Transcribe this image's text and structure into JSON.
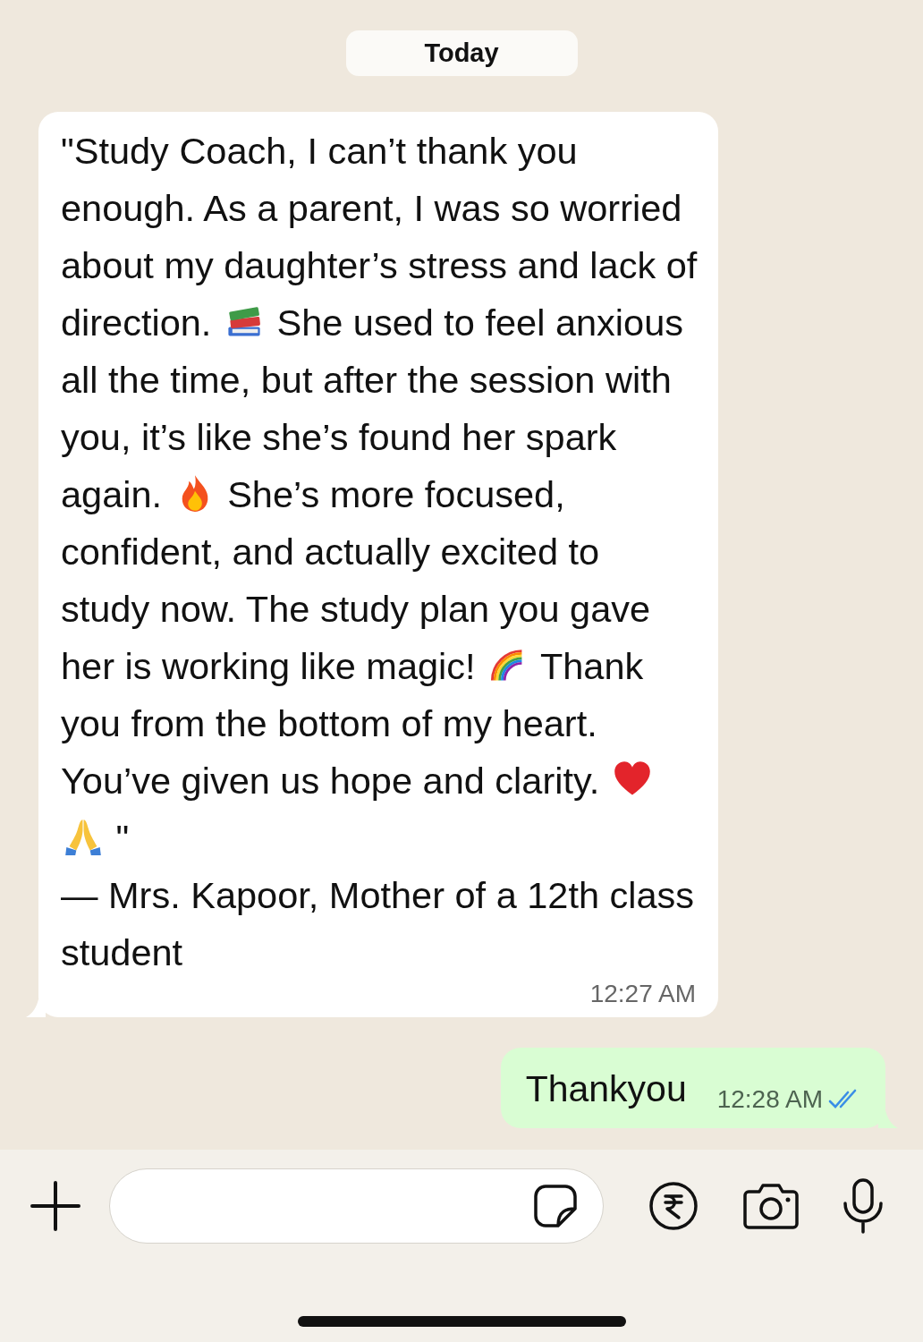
{
  "date_chip": "Today",
  "messages": [
    {
      "kind": "incoming",
      "segments": [
        {
          "kind": "text",
          "text": "\"Study Coach, I can’t thank you enough. As a parent, I was so worried about my daughter’s stress and lack of direction. "
        },
        {
          "kind": "books"
        },
        {
          "kind": "text",
          "text": " She used to feel anxious all the time, but after the session with you, it’s like she’s found her spark again. "
        },
        {
          "kind": "fire"
        },
        {
          "kind": "text",
          "text": " She’s more focused, confident, and actually excited to study now. The study plan you gave her is working like magic! "
        },
        {
          "kind": "rainbow"
        },
        {
          "kind": "text",
          "text": " Thank you from the bottom of my heart. You’ve given us hope and clarity. "
        },
        {
          "kind": "heart"
        },
        {
          "kind": "hands"
        },
        {
          "kind": "text",
          "text": " \""
        }
      ],
      "signature": "— Mrs. Kapoor, Mother of a 12th class student",
      "time": "12:27 AM",
      "read": false
    },
    {
      "kind": "outgoing",
      "segments": [
        {
          "kind": "text",
          "text": "Thankyou"
        }
      ],
      "time": "12:28 AM",
      "read": true
    }
  ]
}
